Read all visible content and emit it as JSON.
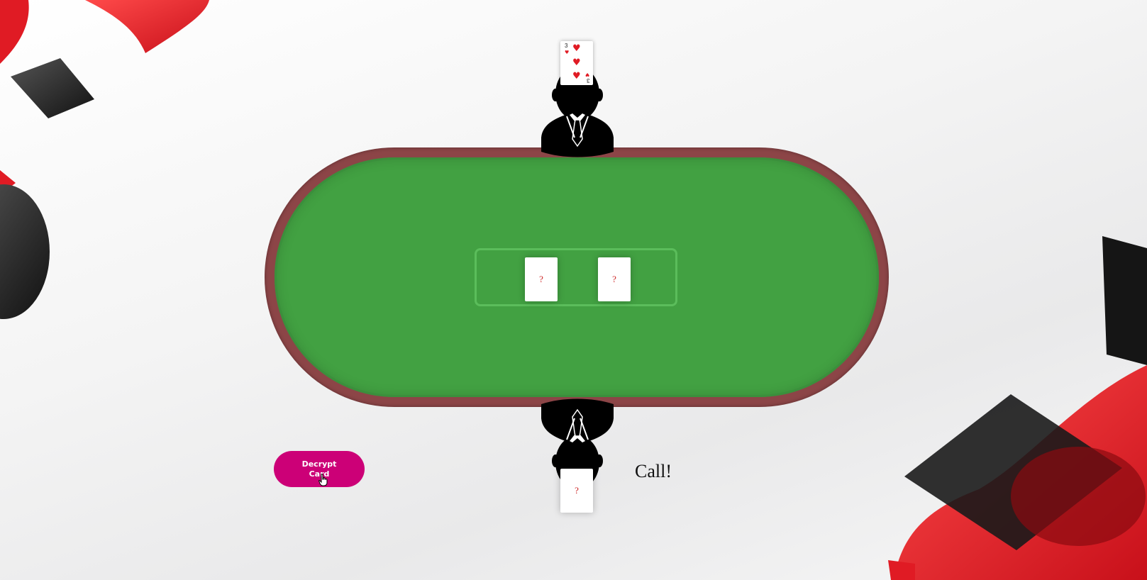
{
  "background": {
    "decor": [
      "heart-icon",
      "diamond-icon",
      "spade-icon",
      "club-icon"
    ],
    "colors": {
      "red": "#e01b24",
      "black": "#1c1c1c"
    }
  },
  "table": {
    "rail_color": "#8c4547",
    "felt_color": "#42a142",
    "community_cards": [
      {
        "face": "?"
      },
      {
        "face": "?"
      }
    ]
  },
  "opponent": {
    "card": {
      "rank": "3",
      "suit": "heart-icon",
      "pip_count": 3
    }
  },
  "player": {
    "hand_card": {
      "face": "?"
    }
  },
  "actions": {
    "decrypt_label": "Decrypt Card",
    "button_color": "#cc0077"
  },
  "status": {
    "message": "Call!"
  }
}
